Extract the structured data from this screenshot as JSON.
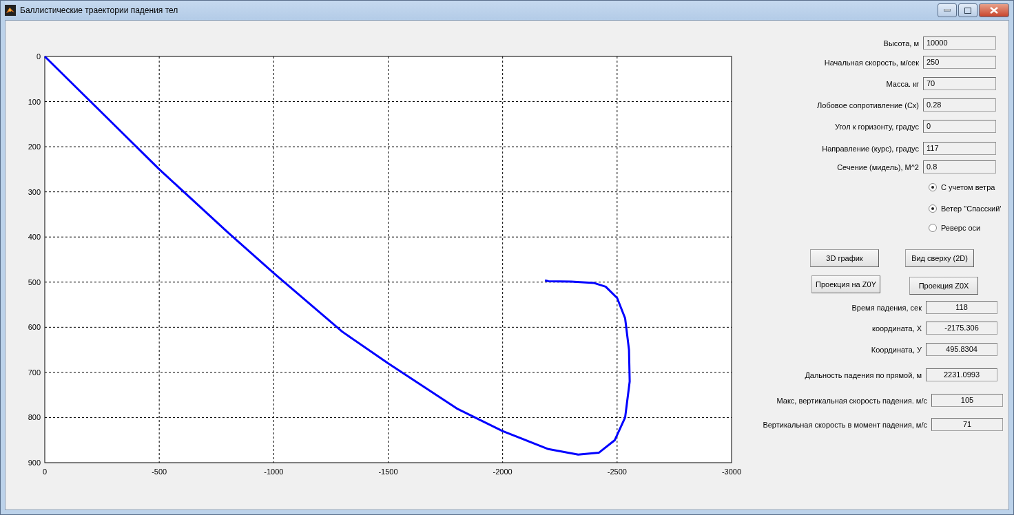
{
  "window": {
    "title": "Баллистические траектории падения тел"
  },
  "chart": {
    "chart_data": {
      "type": "line",
      "grid": true,
      "xlim": [
        0,
        -3000
      ],
      "ylim": [
        900,
        0
      ],
      "xticks": [
        0,
        -500,
        -1000,
        -1500,
        -2000,
        -2500,
        -3000
      ],
      "yticks": [
        0,
        100,
        200,
        300,
        400,
        500,
        600,
        700,
        800,
        900
      ],
      "x": [
        0,
        -100,
        -200,
        -500,
        -800,
        -1000,
        -1300,
        -1500,
        -1800,
        -2000,
        -2200,
        -2330,
        -2420,
        -2490,
        -2535,
        -2555,
        -2552,
        -2535,
        -2500,
        -2450,
        -2400,
        -2300,
        -2200,
        -2185
      ],
      "series": [
        {
          "color": "#0000ff",
          "values": [
            0,
            50,
            100,
            250,
            390,
            480,
            610,
            680,
            780,
            830,
            870,
            882,
            878,
            850,
            800,
            720,
            650,
            580,
            535,
            510,
            502,
            499,
            498,
            496
          ]
        }
      ]
    }
  },
  "inputs": [
    {
      "label": "Высота, м",
      "value": "10000"
    },
    {
      "label": "Начальная скорость, м/сек",
      "value": "250"
    },
    {
      "label": "Масса. кг",
      "value": "70"
    },
    {
      "label": "Лобовое сопротивление (Cx)",
      "value": "0.28"
    },
    {
      "label": "Угол к горизонту, градус",
      "value": "0"
    },
    {
      "label": "Направление  (курс), градус",
      "value": "117"
    },
    {
      "label": "Сечение (мидель), М^2",
      "value": "0.8"
    }
  ],
  "options": [
    {
      "label": "С учетом ветра",
      "checked": true
    },
    {
      "label": "Ветер \"Спасский'",
      "checked": true
    },
    {
      "label": "Реверс оси",
      "checked": false
    }
  ],
  "buttons": [
    "3D график",
    "Вид сверху (2D)",
    "Проекция на Z0Y",
    "Проекция Z0X"
  ],
  "outputs": [
    {
      "label": "Время падения, сек",
      "value": "118"
    },
    {
      "label": "координата, X",
      "value": "-2175.306"
    },
    {
      "label": "Координата, У",
      "value": "495.8304"
    },
    {
      "label": "Дальность падения по прямой, м",
      "value": "2231.0993"
    },
    {
      "label": "Макс,  вертикальная скорость падения. м/с",
      "value": "105"
    },
    {
      "label": "Вертикальная  скорость в момент падения, м/с",
      "value": "71"
    }
  ]
}
